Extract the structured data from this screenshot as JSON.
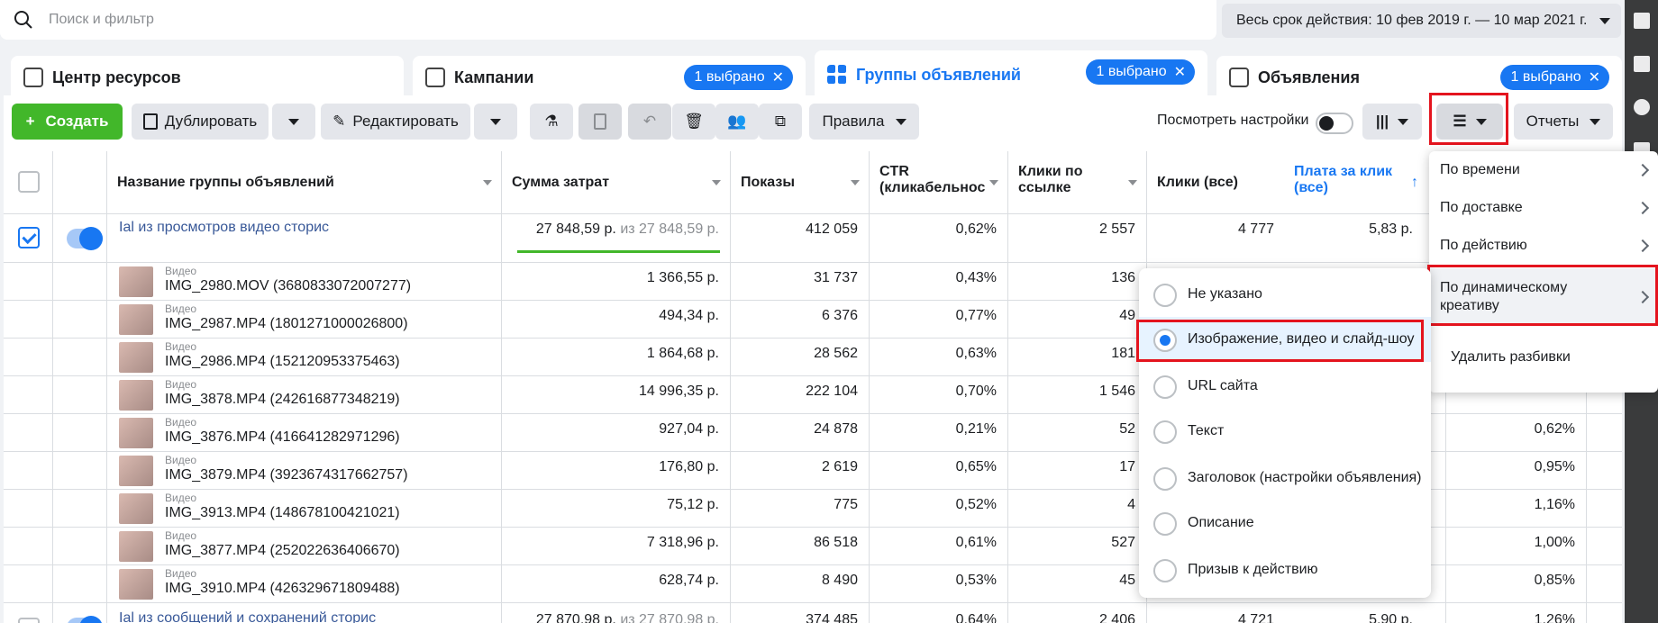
{
  "search": {
    "placeholder": "Поиск и фильтр"
  },
  "date_range": "Весь срок действия: 10 фев 2019 г. — 10 мар 2021 г.",
  "tabs": [
    {
      "label": "Центр ресурсов"
    },
    {
      "label": "Кампании",
      "badge": "1 выбрано"
    },
    {
      "label": "Группы объявлений",
      "badge": "1 выбрано"
    },
    {
      "label": "Объявления",
      "badge": "1 выбрано"
    }
  ],
  "toolbar": {
    "create": "Создать",
    "duplicate": "Дублировать",
    "edit": "Редактировать",
    "rules": "Правила",
    "view_settings": "Посмотреть настройки",
    "reports": "Отчеты"
  },
  "columns": [
    "Название группы объявлений",
    "Сумма затрат",
    "Показы",
    "CTR (кликабельнос",
    "Клики по ссылке",
    "Клики (все)",
    "Плата за клик (все)"
  ],
  "adset_row": {
    "name": "Ial из просмотров видео сторис",
    "spend": "27 848,59 р.",
    "spend_of": "из 27 848,59 р.",
    "impressions": "412 059",
    "ctr": "0,62%",
    "link_clicks": "2 557",
    "clicks": "4 777",
    "cpc": "5,83 р."
  },
  "breakdown_rows": [
    {
      "cat": "Видео",
      "name": "IMG_2980.MOV (3680833072007277)",
      "spend": "1 366,55 р.",
      "impressions": "31 737",
      "ctr": "0,43%",
      "link_clicks": "136",
      "last": ""
    },
    {
      "cat": "Видео",
      "name": "IMG_2987.MP4 (1801271000026800)",
      "spend": "494,34 р.",
      "impressions": "6 376",
      "ctr": "0,77%",
      "link_clicks": "49",
      "last": ""
    },
    {
      "cat": "Видео",
      "name": "IMG_2986.MP4 (152120953375463)",
      "spend": "1 864,68 р.",
      "impressions": "28 562",
      "ctr": "0,63%",
      "link_clicks": "181",
      "last": ""
    },
    {
      "cat": "Видео",
      "name": "IMG_3878.MP4 (242616877348219)",
      "spend": "14 996,35 р.",
      "impressions": "222 104",
      "ctr": "0,70%",
      "link_clicks": "1 546",
      "last": ""
    },
    {
      "cat": "Видео",
      "name": "IMG_3876.MP4 (416641282971296)",
      "spend": "927,04 р.",
      "impressions": "24 878",
      "ctr": "0,21%",
      "link_clicks": "52",
      "last": "0,62%"
    },
    {
      "cat": "Видео",
      "name": "IMG_3879.MP4 (3923674317662757)",
      "spend": "176,80 р.",
      "impressions": "2 619",
      "ctr": "0,65%",
      "link_clicks": "17",
      "last": "0,95%"
    },
    {
      "cat": "Видео",
      "name": "IMG_3913.MP4 (148678100421021)",
      "spend": "75,12 р.",
      "impressions": "775",
      "ctr": "0,52%",
      "link_clicks": "4",
      "last": "1,16%"
    },
    {
      "cat": "Видео",
      "name": "IMG_3877.MP4 (252022636406670)",
      "spend": "7 318,96 р.",
      "impressions": "86 518",
      "ctr": "0,61%",
      "link_clicks": "527",
      "last": "1,00%"
    },
    {
      "cat": "Видео",
      "name": "IMG_3910.MP4 (426329671809488)",
      "spend": "628,74 р.",
      "impressions": "8 490",
      "ctr": "0,53%",
      "link_clicks": "45",
      "last": "0,85%"
    }
  ],
  "partial_row": {
    "name": "Ial из сообщений и сохранений сторис",
    "spend": "27 870,98 р.",
    "spend_of": "из 27 870,98 р.",
    "impressions": "374 485",
    "ctr": "0,64%",
    "link_clicks": "2 406",
    "clicks": "4 721",
    "cpc": "5,90 р.",
    "last": "1,26%"
  },
  "breakdown_menu": [
    {
      "label": "По времени"
    },
    {
      "label": "По доставке"
    },
    {
      "label": "По действию"
    },
    {
      "label": "По динамическому креативу"
    },
    {
      "label": "Удалить разбивки"
    }
  ],
  "creative_submenu": [
    {
      "label": "Не указано",
      "selected": false
    },
    {
      "label": "Изображение, видео и слайд-шоу",
      "selected": true
    },
    {
      "label": "URL сайта",
      "selected": false
    },
    {
      "label": "Текст",
      "selected": false
    },
    {
      "label": "Заголовок (настройки объявления)",
      "selected": false
    },
    {
      "label": "Описание",
      "selected": false
    },
    {
      "label": "Призыв к действию",
      "selected": false
    }
  ],
  "colors": {
    "accent": "#1877f2",
    "create": "#42b72a",
    "highlight": "#e4141e"
  }
}
